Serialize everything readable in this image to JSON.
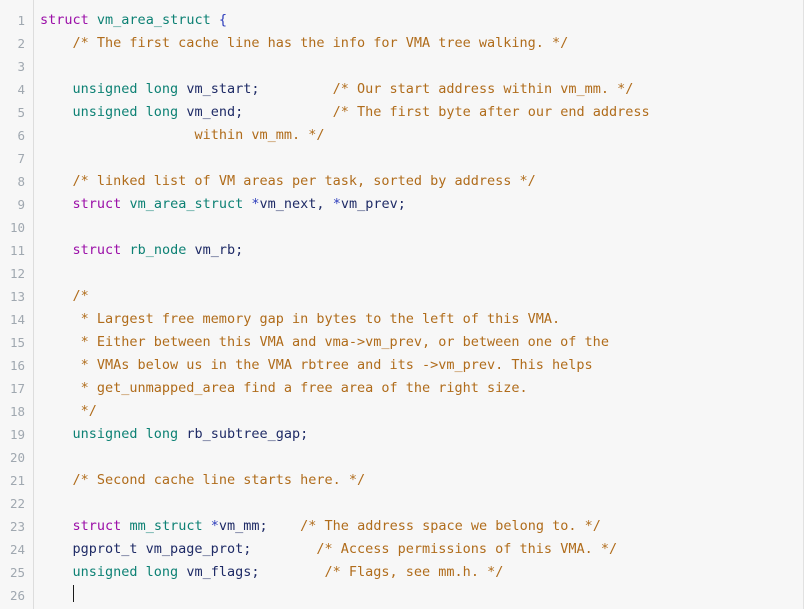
{
  "editor": {
    "language": "c",
    "background_color": "#f7f7f7",
    "gutter_color": "#f7f7f7",
    "line_number_color": "#a0a8b0",
    "colors": {
      "keyword": "#9b0fa8",
      "type": "#0d8174",
      "identifier": "#1f2b66",
      "comment": "#b06c1b",
      "punctuation": "#2b3bbb"
    },
    "cursor": {
      "line": 26,
      "column": 1,
      "color": "#1a1a1a"
    },
    "line_numbers": [
      "1",
      "2",
      "3",
      "4",
      "5",
      "6",
      "7",
      "8",
      "9",
      "10",
      "11",
      "12",
      "13",
      "14",
      "15",
      "16",
      "17",
      "18",
      "19",
      "20",
      "21",
      "22",
      "23",
      "24",
      "25",
      "26"
    ],
    "lines": [
      {
        "n": "1",
        "tokens": [
          {
            "t": "kw",
            "s": "struct"
          },
          {
            "t": "plain",
            "s": " "
          },
          {
            "t": "type",
            "s": "vm_area_struct"
          },
          {
            "t": "plain",
            "s": " "
          },
          {
            "t": "punc",
            "s": "{"
          }
        ]
      },
      {
        "n": "2",
        "tokens": [
          {
            "t": "plain",
            "s": "    "
          },
          {
            "t": "comment",
            "s": "/* The first cache line has the info for VMA tree walking. */"
          }
        ]
      },
      {
        "n": "3",
        "tokens": [
          {
            "t": "plain",
            "s": ""
          }
        ]
      },
      {
        "n": "4",
        "tokens": [
          {
            "t": "plain",
            "s": "    "
          },
          {
            "t": "type",
            "s": "unsigned long"
          },
          {
            "t": "plain",
            "s": " "
          },
          {
            "t": "ident",
            "s": "vm_start;"
          },
          {
            "t": "plain",
            "s": "         "
          },
          {
            "t": "comment",
            "s": "/* Our start address within vm_mm. */"
          }
        ]
      },
      {
        "n": "5",
        "tokens": [
          {
            "t": "plain",
            "s": "    "
          },
          {
            "t": "type",
            "s": "unsigned long"
          },
          {
            "t": "plain",
            "s": " "
          },
          {
            "t": "ident",
            "s": "vm_end;"
          },
          {
            "t": "plain",
            "s": "           "
          },
          {
            "t": "comment",
            "s": "/* The first byte after our end address"
          }
        ]
      },
      {
        "n": "6",
        "tokens": [
          {
            "t": "plain",
            "s": "                   "
          },
          {
            "t": "comment",
            "s": "within vm_mm. */"
          }
        ]
      },
      {
        "n": "7",
        "tokens": [
          {
            "t": "plain",
            "s": ""
          }
        ]
      },
      {
        "n": "8",
        "tokens": [
          {
            "t": "plain",
            "s": "    "
          },
          {
            "t": "comment",
            "s": "/* linked list of VM areas per task, sorted by address */"
          }
        ]
      },
      {
        "n": "9",
        "tokens": [
          {
            "t": "plain",
            "s": "    "
          },
          {
            "t": "kw",
            "s": "struct"
          },
          {
            "t": "plain",
            "s": " "
          },
          {
            "t": "type",
            "s": "vm_area_struct"
          },
          {
            "t": "plain",
            "s": " "
          },
          {
            "t": "punc",
            "s": "*"
          },
          {
            "t": "ident",
            "s": "vm_next"
          },
          {
            "t": "plain",
            "s": ", "
          },
          {
            "t": "punc",
            "s": "*"
          },
          {
            "t": "ident",
            "s": "vm_prev;"
          }
        ]
      },
      {
        "n": "10",
        "tokens": [
          {
            "t": "plain",
            "s": ""
          }
        ]
      },
      {
        "n": "11",
        "tokens": [
          {
            "t": "plain",
            "s": "    "
          },
          {
            "t": "kw",
            "s": "struct"
          },
          {
            "t": "plain",
            "s": " "
          },
          {
            "t": "type",
            "s": "rb_node"
          },
          {
            "t": "plain",
            "s": " "
          },
          {
            "t": "ident",
            "s": "vm_rb;"
          }
        ]
      },
      {
        "n": "12",
        "tokens": [
          {
            "t": "plain",
            "s": ""
          }
        ]
      },
      {
        "n": "13",
        "tokens": [
          {
            "t": "plain",
            "s": "    "
          },
          {
            "t": "comment",
            "s": "/*"
          }
        ]
      },
      {
        "n": "14",
        "tokens": [
          {
            "t": "plain",
            "s": "     "
          },
          {
            "t": "comment",
            "s": "* Largest free memory gap in bytes to the left of this VMA."
          }
        ]
      },
      {
        "n": "15",
        "tokens": [
          {
            "t": "plain",
            "s": "     "
          },
          {
            "t": "comment",
            "s": "* Either between this VMA and vma->vm_prev, or between one of the"
          }
        ]
      },
      {
        "n": "16",
        "tokens": [
          {
            "t": "plain",
            "s": "     "
          },
          {
            "t": "comment",
            "s": "* VMAs below us in the VMA rbtree and its ->vm_prev. This helps"
          }
        ]
      },
      {
        "n": "17",
        "tokens": [
          {
            "t": "plain",
            "s": "     "
          },
          {
            "t": "comment",
            "s": "* get_unmapped_area find a free area of the right size."
          }
        ]
      },
      {
        "n": "18",
        "tokens": [
          {
            "t": "plain",
            "s": "     "
          },
          {
            "t": "comment",
            "s": "*/"
          }
        ]
      },
      {
        "n": "19",
        "tokens": [
          {
            "t": "plain",
            "s": "    "
          },
          {
            "t": "type",
            "s": "unsigned long"
          },
          {
            "t": "plain",
            "s": " "
          },
          {
            "t": "ident",
            "s": "rb_subtree_gap;"
          }
        ]
      },
      {
        "n": "20",
        "tokens": [
          {
            "t": "plain",
            "s": ""
          }
        ]
      },
      {
        "n": "21",
        "tokens": [
          {
            "t": "plain",
            "s": "    "
          },
          {
            "t": "comment",
            "s": "/* Second cache line starts here. */"
          }
        ]
      },
      {
        "n": "22",
        "tokens": [
          {
            "t": "plain",
            "s": ""
          }
        ]
      },
      {
        "n": "23",
        "tokens": [
          {
            "t": "plain",
            "s": "    "
          },
          {
            "t": "kw",
            "s": "struct"
          },
          {
            "t": "plain",
            "s": " "
          },
          {
            "t": "type",
            "s": "mm_struct"
          },
          {
            "t": "plain",
            "s": " "
          },
          {
            "t": "punc",
            "s": "*"
          },
          {
            "t": "ident",
            "s": "vm_mm;"
          },
          {
            "t": "plain",
            "s": "    "
          },
          {
            "t": "comment",
            "s": "/* The address space we belong to. */"
          }
        ]
      },
      {
        "n": "24",
        "tokens": [
          {
            "t": "plain",
            "s": "    "
          },
          {
            "t": "ident",
            "s": "pgprot_t vm_page_prot;"
          },
          {
            "t": "plain",
            "s": "        "
          },
          {
            "t": "comment",
            "s": "/* Access permissions of this VMA. */"
          }
        ]
      },
      {
        "n": "25",
        "tokens": [
          {
            "t": "plain",
            "s": "    "
          },
          {
            "t": "type",
            "s": "unsigned long"
          },
          {
            "t": "plain",
            "s": " "
          },
          {
            "t": "ident",
            "s": "vm_flags;"
          },
          {
            "t": "plain",
            "s": "        "
          },
          {
            "t": "comment",
            "s": "/* Flags, see mm.h. */"
          }
        ]
      },
      {
        "n": "26",
        "tokens": [
          {
            "t": "plain",
            "s": "    "
          },
          {
            "t": "cursor",
            "s": ""
          }
        ]
      }
    ]
  }
}
